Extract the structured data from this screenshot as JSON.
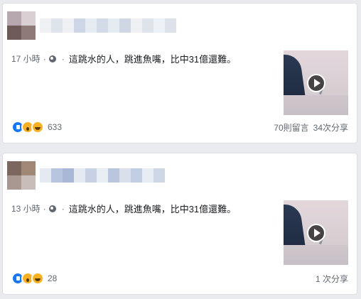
{
  "colors": {
    "link_blue": "#1877f2",
    "meta_gray": "#606770",
    "bg": "#e9ebee"
  },
  "posts": [
    {
      "time": "17 小時",
      "text": "這跳水的人，跳進魚嘴，比中31億還難。",
      "reaction_count": "633",
      "comments": "70則留言",
      "shares": "34次分享"
    },
    {
      "time": "13 小時",
      "text": "這跳水的人，跳進魚嘴，比中31億還難。",
      "reaction_count": "28",
      "comments": "",
      "shares": "1 次分享"
    }
  ]
}
